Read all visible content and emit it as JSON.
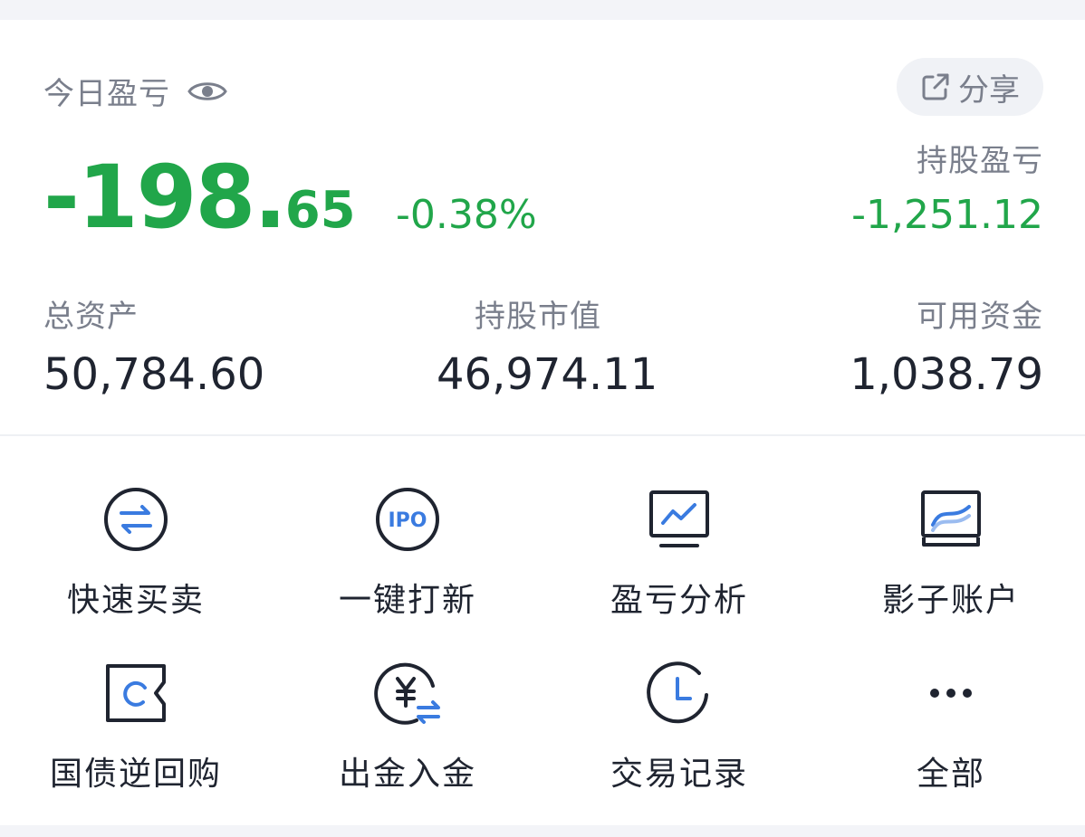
{
  "today_pnl": {
    "title": "今日盈亏",
    "value_int": "-198.",
    "value_dec": "65",
    "percent": "-0.38%"
  },
  "share": {
    "label": "分享"
  },
  "holding_pnl": {
    "title": "持股盈亏",
    "value": "-1,251.12"
  },
  "stats": {
    "total_assets": {
      "label": "总资产",
      "value": "50,784.60"
    },
    "market_value": {
      "label": "持股市值",
      "value": "46,974.11"
    },
    "available": {
      "label": "可用资金",
      "value": "1,038.79"
    }
  },
  "actions": [
    {
      "label": "快速买卖",
      "icon": "exchange-icon"
    },
    {
      "label": "一键打新",
      "icon": "ipo-icon"
    },
    {
      "label": "盈亏分析",
      "icon": "chart-monitor-icon"
    },
    {
      "label": "影子账户",
      "icon": "shadow-account-icon"
    },
    {
      "label": "国债逆回购",
      "icon": "bond-repo-icon"
    },
    {
      "label": "出金入金",
      "icon": "yuan-transfer-icon"
    },
    {
      "label": "交易记录",
      "icon": "clock-icon"
    },
    {
      "label": "全部",
      "icon": "more-icon"
    }
  ],
  "colors": {
    "gain_loss_green": "#21a64a",
    "accent_blue": "#3a7be0",
    "text_dark": "#1f2430",
    "text_gray": "#7a7f8c"
  }
}
